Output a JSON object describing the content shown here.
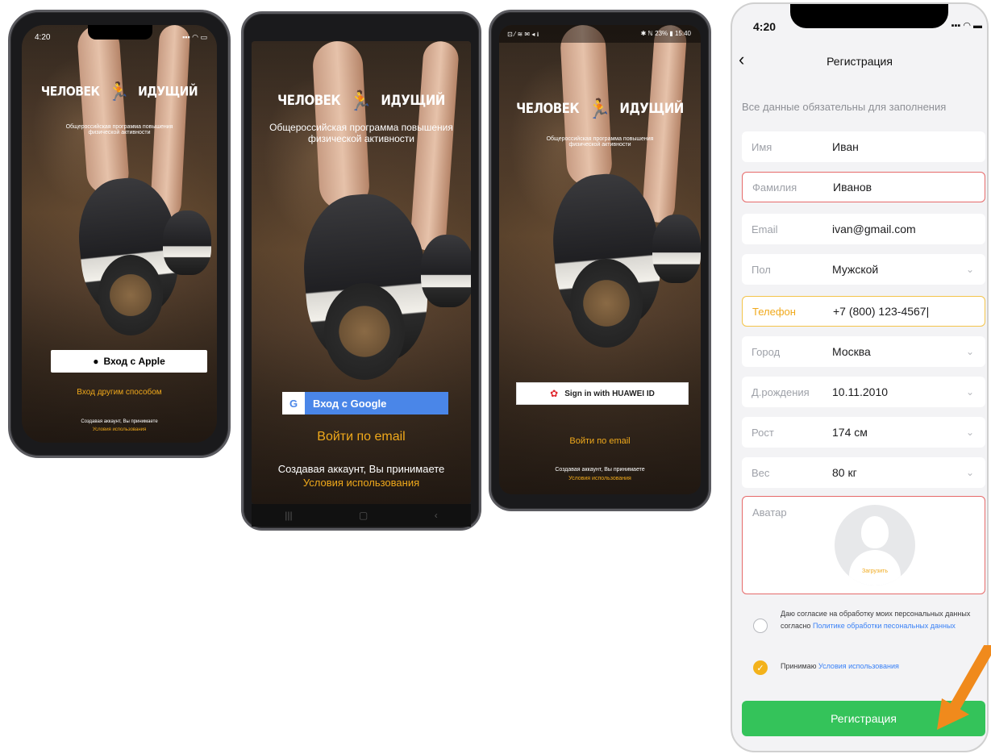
{
  "phone1": {
    "status_time": "4:20",
    "logo_left": "ЧЕЛОВЕК",
    "logo_right": "ИДУЩИЙ",
    "tagline": "Общероссийская программа повышения физической активности",
    "apple_button": "Вход с Apple",
    "other_login": "Вход другим способом",
    "terms_line": "Создавая аккаунт, Вы принимаете",
    "terms_link": "Условия использования"
  },
  "phone2": {
    "logo_left": "ЧЕЛОВЕК",
    "logo_right": "ИДУЩИЙ",
    "tagline": "Общероссийская программа повышения физической активности",
    "google_button": "Вход с Google",
    "email_login": "Войти по email",
    "terms_line": "Создавая аккаунт, Вы принимаете",
    "terms_link": "Условия использования"
  },
  "phone3": {
    "status_left": "⊡ ⁄ ≋ ✉ ◂ ⭳",
    "status_right": "✱ ℕ 23% ▮ 15:40",
    "logo_left": "ЧЕЛОВЕК",
    "logo_right": "ИДУЩИЙ",
    "tagline": "Общероссийская программа повышения физической активности",
    "huawei_button": "Sign in with HUAWEI ID",
    "email_login": "Войти по email",
    "terms_line": "Создавая аккаунт, Вы принимаете",
    "terms_link": "Условия использования"
  },
  "registration": {
    "status_time": "4:20",
    "title": "Регистрация",
    "note": "Все данные обязательны для заполнения",
    "fields": [
      {
        "label": "Имя",
        "value": "Иван",
        "dropdown": false,
        "state": "normal"
      },
      {
        "label": "Фамилия",
        "value": "Иванов",
        "dropdown": false,
        "state": "error"
      },
      {
        "label": "Email",
        "value": "ivan@gmail.com",
        "dropdown": false,
        "state": "normal"
      },
      {
        "label": "Пол",
        "value": "Мужской",
        "dropdown": true,
        "state": "normal"
      },
      {
        "label": "Телефон",
        "value": "+7 (800) 123-4567|",
        "dropdown": false,
        "state": "focus"
      },
      {
        "label": "Город",
        "value": "Москва",
        "dropdown": true,
        "state": "normal"
      },
      {
        "label": "Д.рождения",
        "value": "10.11.2010",
        "dropdown": true,
        "state": "normal"
      },
      {
        "label": "Рост",
        "value": "174 см",
        "dropdown": true,
        "state": "normal"
      },
      {
        "label": "Вес",
        "value": "80 кг",
        "dropdown": true,
        "state": "normal"
      }
    ],
    "avatar_label": "Аватар",
    "upload_label": "Загрузить",
    "consent_text": "Даю согласие на обработку моих персональных данных согласно",
    "consent_link": "Политике обработки песональных данных",
    "accept_text": "Принимаю",
    "accept_link": "Условия использования",
    "submit": "Регистрация"
  },
  "colors": {
    "orange": "#f0a91b",
    "green": "#34c35a",
    "error_border": "#e66a6a",
    "focus_border": "#f3c44a",
    "google_blue": "#4a86e8",
    "link_blue": "#3b82f6",
    "arrow": "#f08a1c"
  }
}
